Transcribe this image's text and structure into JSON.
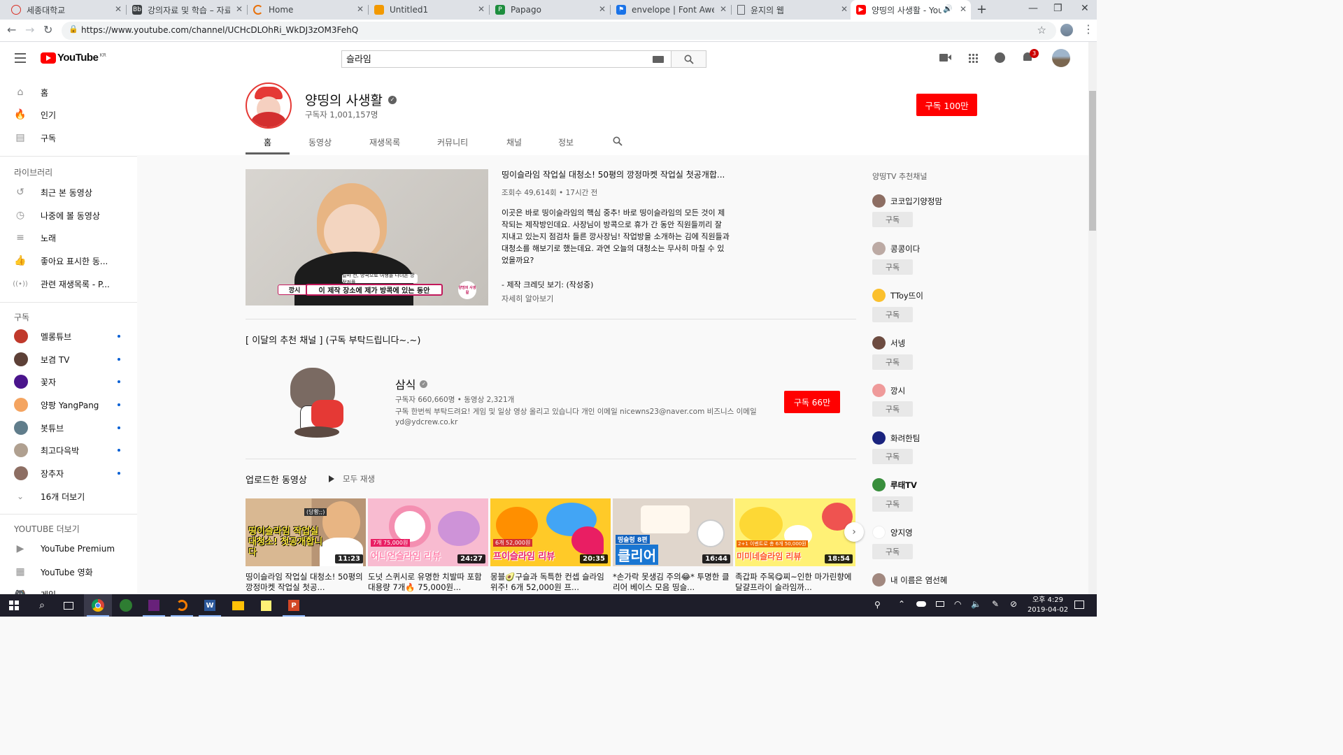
{
  "browser": {
    "tabs": [
      {
        "label": "세종대학교",
        "icon_color": "#d93025",
        "active": false
      },
      {
        "label": "강의자료 및 학습 – 자료",
        "icon_color": "#3c4043",
        "active": false
      },
      {
        "label": "Home",
        "icon_color": "#e8710a",
        "active": false
      },
      {
        "label": "Untitled1",
        "icon_color": "#f29900",
        "active": false
      },
      {
        "label": "Papago",
        "icon_color": "#1e8e3e",
        "active": false
      },
      {
        "label": "envelope | Font Awesome",
        "icon_color": "#1a73e8",
        "active": false
      },
      {
        "label": "윤지의 웹",
        "icon_color": "#80868b",
        "active": false
      },
      {
        "label": "양띵의 사생활 - YouTube",
        "icon_color": "#ff0000",
        "active": true
      }
    ],
    "url": "https://www.youtube.com/channel/UCHcDLOhRi_WkDJ3zOM3FehQ"
  },
  "masthead": {
    "logo_text": "YouTube",
    "logo_region": "KR",
    "search_value": "슬라임",
    "notification_count": "3"
  },
  "sidebar": {
    "main": [
      {
        "label": "홈",
        "icon": "home-icon"
      },
      {
        "label": "인기",
        "icon": "trending-icon"
      },
      {
        "label": "구독",
        "icon": "subscriptions-icon"
      }
    ],
    "library_header": "라이브러리",
    "library": [
      {
        "label": "최근 본 동영상",
        "icon": "history-icon"
      },
      {
        "label": "나중에 볼 동영상",
        "icon": "watch-later-icon"
      },
      {
        "label": "노래",
        "icon": "playlist-icon"
      },
      {
        "label": "좋아요 표시한 동...",
        "icon": "like-icon"
      },
      {
        "label": "관련 재생목록 - P...",
        "icon": "live-icon"
      }
    ],
    "subs_header": "구독",
    "subscriptions": [
      {
        "label": "멜롱튜브",
        "color": "#c0392b"
      },
      {
        "label": "보겸 TV",
        "color": "#5d4037"
      },
      {
        "label": "꽃자",
        "color": "#4a148c"
      },
      {
        "label": "양팡 YangPang",
        "color": "#f4a460"
      },
      {
        "label": "봇튜브",
        "color": "#607d8b"
      },
      {
        "label": "최고다윽박",
        "color": "#b0a090"
      },
      {
        "label": "장추자",
        "color": "#8d6e63"
      }
    ],
    "more_label": "16개 더보기",
    "more_header": "YOUTUBE 더보기",
    "more": [
      {
        "label": "YouTube Premium",
        "icon": "youtube-premium-icon"
      },
      {
        "label": "YouTube 영화",
        "icon": "movies-icon"
      },
      {
        "label": "게임",
        "icon": "gaming-icon"
      }
    ]
  },
  "channel": {
    "name": "양띵의 사생활",
    "subscribers": "구독자 1,001,157명",
    "subscribe_label": "구독",
    "subscribe_count": "100만",
    "tabs": [
      "홈",
      "동영상",
      "재생목록",
      "커뮤니티",
      "채널",
      "정보"
    ]
  },
  "featured": {
    "title": "띵이슬라임 작업실 대청소! 50평의 깡정마켓 작업실 첫공개합...",
    "meta": "조회수 49,614회 • 17시간 전",
    "description": "이곳은 바로 띵이슬라임의 핵심 중추! 바로 띵이슬라임의 모든 것이 제작되는 제작방인데요. 사장님이 방콕으로 휴가 간 동안 직원들끼리 잘 지내고 있는지 점검차 들른 깡사장님! 작업방을 소개하는 김에 직원들과 대청소를 해보기로 했는데요. 과연 오늘의 대청소는 무사히 마칠 수 있었을까요?",
    "credits": "- 제작 크레딧 보기: (작성중)",
    "more": "자세히 알아보기",
    "caption_top": "얼마 전, 방콕으로 여행을 다녀온 깡정커플",
    "caption_main": "이 제작 장소에 제가 방콕에 있는 동안",
    "caption_tag": "깡시",
    "caption_logo": "양띵의 사생활"
  },
  "recommended_section": {
    "title": "[ 이달의 추천 채널 ] (구독 부탁드립니다~.~)",
    "channel_name": "삼식",
    "meta": "구독자 660,660명 • 동영상 2,321개",
    "description": "구독 한번씩 부탁드려요! 게임 및 일상 영상 올리고 있습니다 개인 이메일 nicewns23@naver.com 비즈니스 이메일 yd@ydcrew.co.kr",
    "subscribe_label": "구독",
    "subscribe_count": "66만"
  },
  "uploads": {
    "title": "업로드한 동영상",
    "play_all": "모두 재생",
    "videos": [
      {
        "title": "띵이슬라임 작업실 대청소! 50평의 깡정마켓 작업실 첫공...",
        "duration": "11:23",
        "thumb_text": "띵이슬라임 작업실 대청소! 첫공개합니다",
        "bg": "#c8a27a",
        "accent": "#ffeb3b",
        "tag": "(당황;;)"
      },
      {
        "title": "도넛 스퀴시로 유명한 치발따 포함 대용량 7개🔥 75,000원...",
        "duration": "24:27",
        "thumb_text": "어니언슬라임 리뷰",
        "bg": "#f8bbd0",
        "accent": "#ff80ab",
        "tag": "7개 75,000원"
      },
      {
        "title": "몽블🥑구슬과 독특한 컨셉 슬라임 위주! 6개 52,000원 프...",
        "duration": "20:35",
        "thumb_text": "프이슬라임 리뷰",
        "bg": "#ffca28",
        "accent": "#e91e63",
        "tag": "6개 52,000원"
      },
      {
        "title": "*손가락 못생김 주의😂* 투명한 클리어 베이스 모음 띵슬...",
        "duration": "16:44",
        "thumb_text": "클리어",
        "bg": "#e0d6cc",
        "accent": "#1976d2",
        "tag": "띵슬렁 8편"
      },
      {
        "title": "족갑파 주목😋찌~인한 마가린향에 달걀프라이 슬라임까...",
        "duration": "18:54",
        "thumb_text": "미미네슬라임 리뷰",
        "bg": "#fff176",
        "accent": "#ff5722",
        "tag": "2+1 이벤트로 총 6개 50,000원"
      }
    ]
  },
  "sidebar_right": {
    "title": "양띵TV 추천채널",
    "subscribe_label": "구독",
    "channels": [
      {
        "name": "코코입기양정맘",
        "color": "#8d6e63"
      },
      {
        "name": "콩콩이다",
        "color": "#bcaaa4"
      },
      {
        "name": "TToy뜨이",
        "color": "#fbc02d"
      },
      {
        "name": "서넹",
        "color": "#6d4c41"
      },
      {
        "name": "깡시",
        "color": "#ef9a9a"
      },
      {
        "name": "화려한팀",
        "color": "#1a237e"
      },
      {
        "name": "루태TV",
        "color": "#388e3c"
      },
      {
        "name": "양지영",
        "color": "#ffffff"
      },
      {
        "name": "내 이름은 염선혜",
        "color": "#a1887f"
      }
    ]
  },
  "taskbar": {
    "time": "오후 4:29",
    "date": "2019-04-02"
  }
}
